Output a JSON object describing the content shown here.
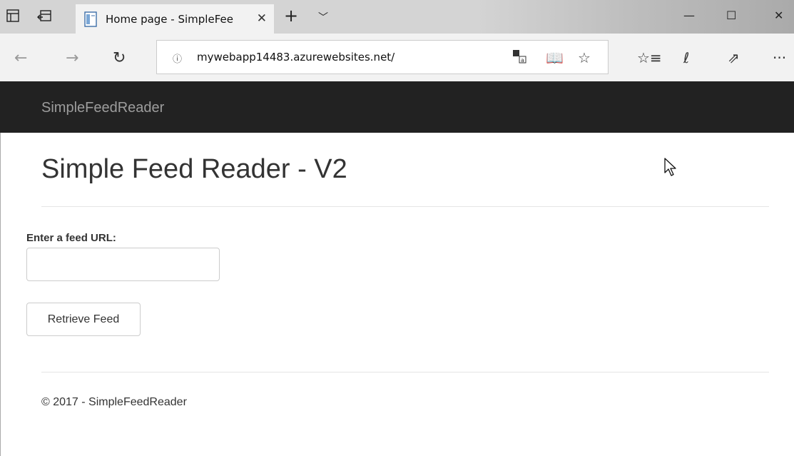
{
  "browser": {
    "tab_title": "Home page - SimpleFee",
    "address": "mywebapp14483.azurewebsites.net/",
    "icons": {
      "tab_actions": "tab-actions-icon",
      "set_aside": "set-aside-icon",
      "favicon": "page-icon",
      "close_tab": "close-icon",
      "new_tab": "plus-icon",
      "tab_menu": "chevron-down-icon",
      "minimize": "minimize-icon",
      "maximize": "maximize-icon",
      "close_window": "close-icon",
      "back": "back-arrow-icon",
      "forward": "forward-arrow-icon",
      "refresh": "refresh-icon",
      "info": "info-icon",
      "translate": "translate-icon",
      "reading_view": "book-icon",
      "favorite": "star-icon",
      "favorites_hub": "favorites-list-icon",
      "web_note": "pen-icon",
      "share": "share-icon",
      "more": "more-icon"
    }
  },
  "site": {
    "brand": "SimpleFeedReader",
    "nav_bg": "#222222"
  },
  "main": {
    "heading": "Simple Feed Reader - V2",
    "feed_label": "Enter a feed URL:",
    "feed_input_value": "",
    "retrieve_button": "Retrieve Feed"
  },
  "footer": {
    "text": "© 2017 - SimpleFeedReader"
  }
}
